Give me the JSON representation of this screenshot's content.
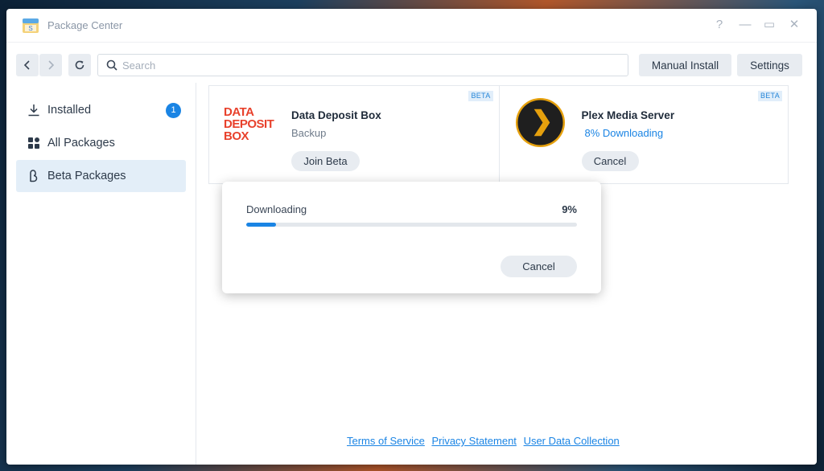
{
  "window": {
    "title": "Package Center",
    "controls": [
      "?",
      "—",
      "▭",
      "✕"
    ]
  },
  "toolbar": {
    "back_icon": "chevron-left-icon",
    "forward_icon": "chevron-right-icon",
    "refresh_icon": "refresh-icon",
    "search_placeholder": "Search",
    "manual_install_label": "Manual Install",
    "settings_label": "Settings"
  },
  "sidebar": {
    "items": [
      {
        "label": "Installed",
        "icon": "download-icon",
        "badge": "1",
        "active": false
      },
      {
        "label": "All Packages",
        "icon": "grid-icon",
        "active": false
      },
      {
        "label": "Beta Packages",
        "icon": "beta-icon",
        "active": true
      }
    ]
  },
  "packages": [
    {
      "name": "Data Deposit Box",
      "subtitle": "Backup",
      "tag": "BETA",
      "button": "Join Beta",
      "logo_lines": [
        "DATA",
        "DEPOSIT",
        "BOX"
      ],
      "logo_color": "#e8412c"
    },
    {
      "name": "Plex Media Server",
      "subtitle": "8% Downloading",
      "tag": "BETA",
      "button": "Cancel",
      "logo_color": "#e5a00d"
    }
  ],
  "dialog": {
    "label": "Downloading",
    "percent_text": "9%",
    "progress": 0.09,
    "cancel_label": "Cancel"
  },
  "footer": {
    "links": [
      "Terms of Service",
      "Privacy Statement",
      "User Data Collection"
    ]
  },
  "colors": {
    "accent": "#1a84e4",
    "active_bg": "#e3eef8",
    "button_bg": "#e8ecf1"
  }
}
